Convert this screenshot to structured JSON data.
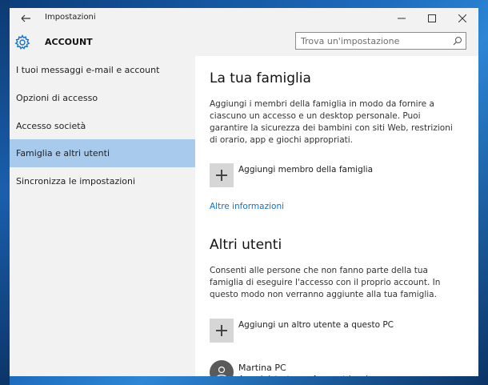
{
  "window": {
    "title": "Impostazioni"
  },
  "header": {
    "section_title": "ACCOUNT",
    "search_placeholder": "Trova un'impostazione"
  },
  "sidebar": {
    "items": [
      {
        "label": "I tuoi messaggi e-mail e account",
        "selected": false
      },
      {
        "label": "Opzioni di accesso",
        "selected": false
      },
      {
        "label": "Accesso società",
        "selected": false
      },
      {
        "label": "Famiglia e altri utenti",
        "selected": true
      },
      {
        "label": "Sincronizza le impostazioni",
        "selected": false
      }
    ]
  },
  "family": {
    "title": "La tua famiglia",
    "description": "Aggiungi i membri della famiglia in modo da fornire a ciascuno un accesso e un desktop personale. Puoi garantire la sicurezza dei bambini con siti Web, restrizioni di orario, app e giochi appropriati.",
    "add_label": "Aggiungi membro della famiglia",
    "more_info_link": "Altre informazioni"
  },
  "other_users": {
    "title": "Altri utenti",
    "description": "Consenti alle persone che non fanno parte della tua famiglia di eseguire l'accesso con il proprio account. In questo modo non verranno aggiunte alla tua famiglia.",
    "add_label": "Aggiungi un altro utente a questo PC",
    "users": [
      {
        "name": "Martina PC",
        "role": "Amministratore - Account locale"
      }
    ]
  },
  "colors": {
    "accent": "#1570c8",
    "selected_nav": "#a8cbed",
    "sidebar_bg": "#f2f2f2"
  },
  "icons": {
    "back": "back-arrow-icon",
    "settings": "gear-icon",
    "search": "search-icon",
    "minimize": "minimize-icon",
    "maximize": "maximize-icon",
    "close": "close-icon",
    "add": "plus-icon",
    "user": "user-icon"
  }
}
